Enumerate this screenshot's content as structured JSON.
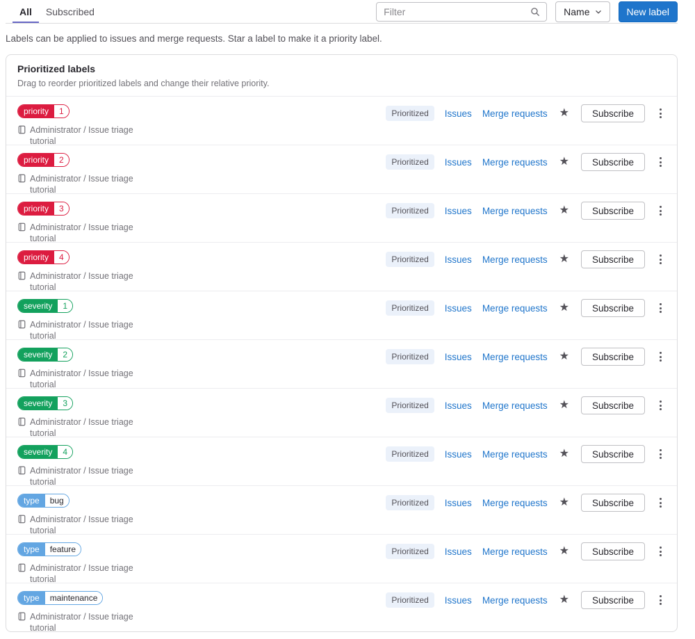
{
  "colors": {
    "primary_button": "#1f75cb",
    "link": "#1f75cb",
    "tab_indicator": "#6666c4",
    "label_red": "#dc1c40",
    "label_green": "#13a15d",
    "label_blue": "#63a6e2",
    "prioritized_badge_bg": "#ebf1fa",
    "row_separator": "#ececef"
  },
  "tabs": {
    "all": "All",
    "subscribed": "Subscribed"
  },
  "toolbar": {
    "filter_placeholder": "Filter",
    "sort_label": "Name",
    "new_label_button": "New label"
  },
  "description": "Labels can be applied to issues and merge requests. Star a label to make it a priority label.",
  "card": {
    "title": "Prioritized labels",
    "subtitle": "Drag to reorder prioritized labels and change their relative priority.",
    "row_labels": {
      "prioritized": "Prioritized",
      "issues": "Issues",
      "merge_requests": "Merge requests",
      "subscribe": "Subscribe"
    },
    "icons": {
      "star": "★"
    },
    "labels": [
      {
        "scope": "priority",
        "key": "1",
        "color": "#dc1c40",
        "key_text_color": "#dc1c40",
        "project": "Administrator / Issue triage tutorial"
      },
      {
        "scope": "priority",
        "key": "2",
        "color": "#dc1c40",
        "key_text_color": "#dc1c40",
        "project": "Administrator / Issue triage tutorial"
      },
      {
        "scope": "priority",
        "key": "3",
        "color": "#dc1c40",
        "key_text_color": "#dc1c40",
        "project": "Administrator / Issue triage tutorial"
      },
      {
        "scope": "priority",
        "key": "4",
        "color": "#dc1c40",
        "key_text_color": "#dc1c40",
        "project": "Administrator / Issue triage tutorial"
      },
      {
        "scope": "severity",
        "key": "1",
        "color": "#13a15d",
        "key_text_color": "#13a15d",
        "project": "Administrator / Issue triage tutorial"
      },
      {
        "scope": "severity",
        "key": "2",
        "color": "#13a15d",
        "key_text_color": "#13a15d",
        "project": "Administrator / Issue triage tutorial"
      },
      {
        "scope": "severity",
        "key": "3",
        "color": "#13a15d",
        "key_text_color": "#13a15d",
        "project": "Administrator / Issue triage tutorial"
      },
      {
        "scope": "severity",
        "key": "4",
        "color": "#13a15d",
        "key_text_color": "#13a15d",
        "project": "Administrator / Issue triage tutorial"
      },
      {
        "scope": "type",
        "key": "bug",
        "color": "#63a6e2",
        "key_text_color": "#28272d",
        "project": "Administrator / Issue triage tutorial"
      },
      {
        "scope": "type",
        "key": "feature",
        "color": "#63a6e2",
        "key_text_color": "#28272d",
        "project": "Administrator / Issue triage tutorial"
      },
      {
        "scope": "type",
        "key": "maintenance",
        "color": "#63a6e2",
        "key_text_color": "#28272d",
        "project": "Administrator / Issue triage tutorial"
      }
    ]
  }
}
